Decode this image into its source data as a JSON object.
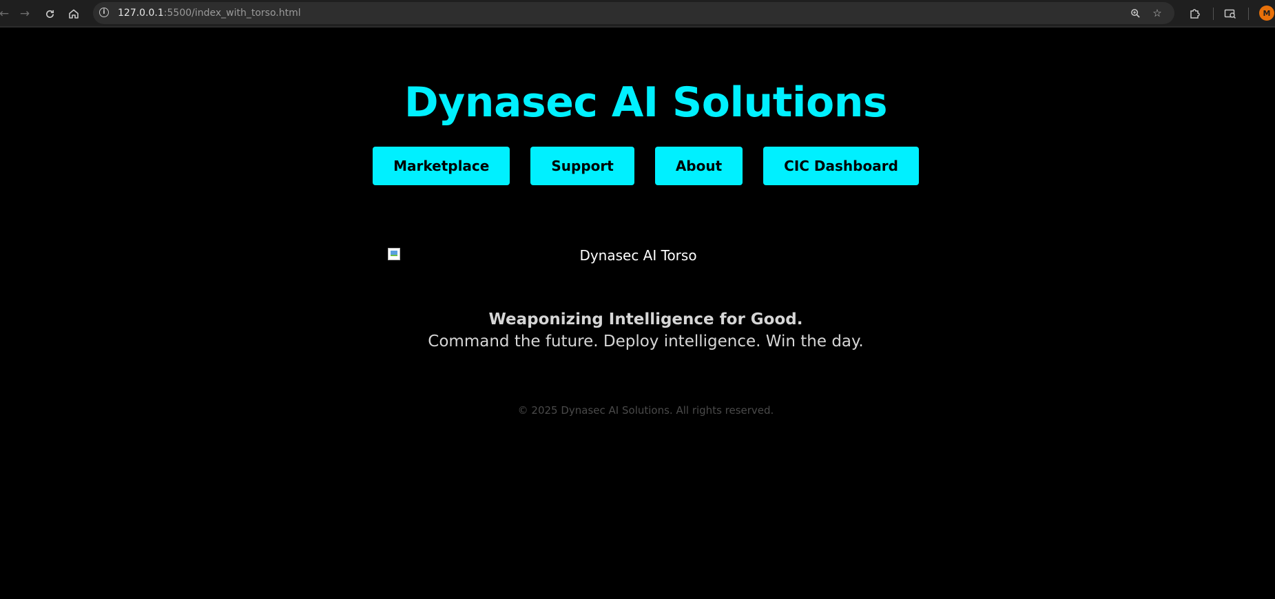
{
  "browser": {
    "url_host": "127.0.0.1",
    "url_rest": ":5500/index_with_torso.html",
    "profile_initial": "M",
    "icons": {
      "back": "arrow-left-icon",
      "forward": "arrow-right-icon",
      "reload": "reload-icon",
      "home": "home-icon",
      "site_info": "info-icon",
      "zoom": "zoom-icon",
      "bookmark": "star-icon",
      "extensions": "puzzle-icon",
      "media": "media-search-icon"
    }
  },
  "site": {
    "title": "Dynasec AI Solutions",
    "accent_color": "#00f0ff",
    "background_color": "#000000",
    "nav": [
      {
        "label": "Marketplace"
      },
      {
        "label": "Support"
      },
      {
        "label": "About"
      },
      {
        "label": "CIC Dashboard"
      }
    ],
    "torso_image_alt": "Dynasec AI Torso",
    "tagline_strong": "Weaponizing Intelligence for Good.",
    "tagline_sub": "Command the future. Deploy intelligence. Win the day.",
    "footer": "© 2025 Dynasec AI Solutions. All rights reserved."
  }
}
